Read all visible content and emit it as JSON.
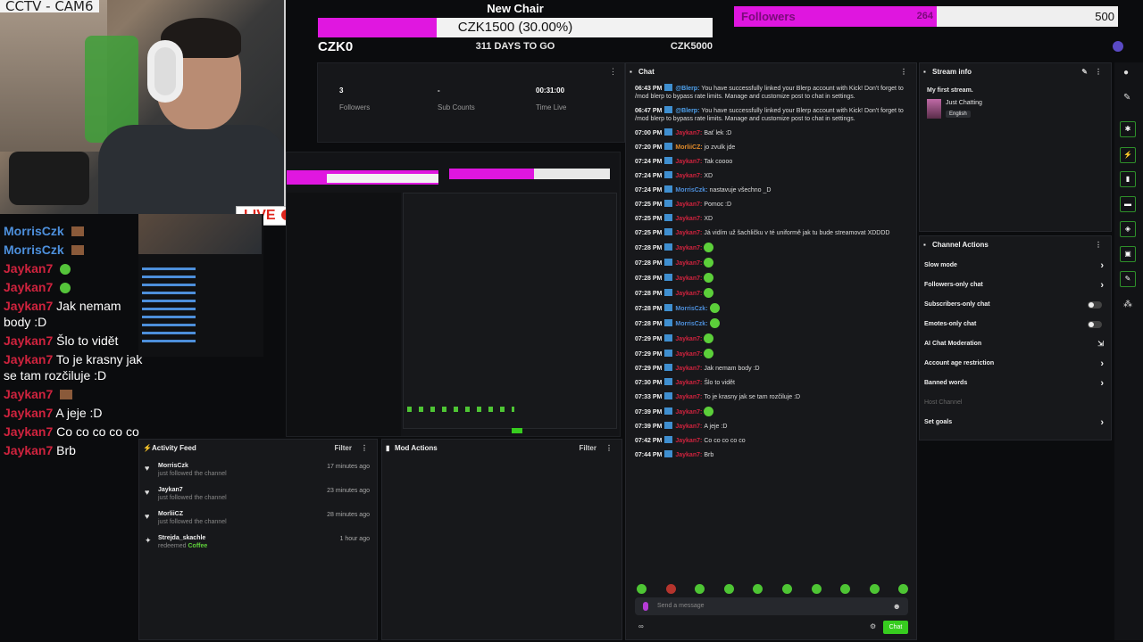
{
  "cam": {
    "label": "CCTV - CAM6",
    "live": "LIVE"
  },
  "goal": {
    "title": "New Chair",
    "progress_text": "CZK1500 (30.00%)",
    "percent": 30,
    "min_label": "CZK0",
    "days_left": "311 DAYS TO GO",
    "max_label": "CZK5000"
  },
  "followers_goal": {
    "label": "Followers",
    "count": "264",
    "goal": "500",
    "fraction": 0.528
  },
  "stats": [
    {
      "value": "3",
      "label": "Followers"
    },
    {
      "value": "-",
      "label": "Sub Counts"
    },
    {
      "value": "00:31:00",
      "label": "Time Live"
    }
  ],
  "overlay_chat": [
    {
      "name": "MorrisCzk",
      "msg": "",
      "color": "#4d8fdb",
      "emote": "brown"
    },
    {
      "name": "MorrisCzk",
      "msg": "",
      "color": "#4d8fdb",
      "emote": "brown"
    },
    {
      "name": "Jaykan7",
      "msg": "",
      "color": "#d0233e",
      "emote": "green"
    },
    {
      "name": "Jaykan7",
      "msg": "",
      "color": "#d0233e",
      "emote": "green"
    },
    {
      "name": "Jaykan7",
      "msg": "Jak nemam body :D",
      "color": "#d0233e",
      "emote": ""
    },
    {
      "name": "Jaykan7",
      "msg": "Šlo to vidět",
      "color": "#d0233e",
      "emote": ""
    },
    {
      "name": "Jaykan7",
      "msg": "To je krasny jak se tam rozčiluje :D",
      "color": "#d0233e",
      "emote": ""
    },
    {
      "name": "Jaykan7",
      "msg": "",
      "color": "#d0233e",
      "emote": "brown"
    },
    {
      "name": "Jaykan7",
      "msg": "A jeje :D",
      "color": "#d0233e",
      "emote": ""
    },
    {
      "name": "Jaykan7",
      "msg": "Co co co co co",
      "color": "#d0233e",
      "emote": ""
    },
    {
      "name": "Jaykan7",
      "msg": "Brb",
      "color": "#d0233e",
      "emote": ""
    }
  ],
  "activity": {
    "title": "Activity Feed",
    "filter": "Filter",
    "rows": [
      {
        "name": "MorrisCzk",
        "sub": "just followed the channel",
        "time": "17 minutes ago",
        "icon": "heart"
      },
      {
        "name": "Jaykan7",
        "sub": "just followed the channel",
        "time": "23 minutes ago",
        "icon": "heart"
      },
      {
        "name": "MorliiCZ",
        "sub": "just followed the channel",
        "time": "28 minutes ago",
        "icon": "heart"
      },
      {
        "name": "Strejda_skachle",
        "sub": "redeemed",
        "reward": "Coffee",
        "time": "1 hour ago",
        "icon": "reward"
      }
    ]
  },
  "mod": {
    "title": "Mod Actions",
    "filter": "Filter"
  },
  "chat": {
    "title": "Chat",
    "messages": [
      {
        "time": "06:43 PM",
        "name": "@Blerp:",
        "cls": "bot",
        "text": "You have successfully linked your Blerp account with Kick! Don't forget to /mod blerp to bypass rate limits. Manage and customize post to chat in settings."
      },
      {
        "time": "06:47 PM",
        "name": "@Blerp:",
        "cls": "bot",
        "text": "You have successfully linked your Blerp account with Kick! Don't forget to /mod blerp to bypass rate limits. Manage and customize post to chat in settings."
      },
      {
        "time": "07:00 PM",
        "name": "Jaykan7:",
        "cls": "red",
        "text": "Bať lek :D"
      },
      {
        "time": "07:20 PM",
        "name": "MorliiCZ:",
        "cls": "orange",
        "text": "jo zvulk jde"
      },
      {
        "time": "07:24 PM",
        "name": "Jaykan7:",
        "cls": "red",
        "text": "Tak coooo"
      },
      {
        "time": "07:24 PM",
        "name": "Jaykan7:",
        "cls": "red",
        "text": "XD"
      },
      {
        "time": "07:24 PM",
        "name": "MorrisCzk:",
        "cls": "blue",
        "text": "nastavuje všechno _D"
      },
      {
        "time": "07:25 PM",
        "name": "Jaykan7:",
        "cls": "red",
        "text": "Pomoc :D"
      },
      {
        "time": "07:25 PM",
        "name": "Jaykan7:",
        "cls": "red",
        "text": "XD"
      },
      {
        "time": "07:25 PM",
        "name": "Jaykan7:",
        "cls": "red",
        "text": "Já vidím už šachličku v té uniformě jak tu bude streamovat XDDDD"
      },
      {
        "time": "07:28 PM",
        "name": "Jaykan7:",
        "cls": "red",
        "text": "",
        "emote": true
      },
      {
        "time": "07:28 PM",
        "name": "Jaykan7:",
        "cls": "red",
        "text": "",
        "emote": true
      },
      {
        "time": "07:28 PM",
        "name": "Jaykan7:",
        "cls": "red",
        "text": "",
        "emote": true
      },
      {
        "time": "07:28 PM",
        "name": "Jaykan7:",
        "cls": "red",
        "text": "",
        "emote": true
      },
      {
        "time": "07:28 PM",
        "name": "MorrisCzk:",
        "cls": "blue",
        "text": "",
        "emote": true
      },
      {
        "time": "07:28 PM",
        "name": "MorrisCzk:",
        "cls": "blue",
        "text": "",
        "emote": true
      },
      {
        "time": "07:29 PM",
        "name": "Jaykan7:",
        "cls": "red",
        "text": "",
        "emote": true
      },
      {
        "time": "07:29 PM",
        "name": "Jaykan7:",
        "cls": "red",
        "text": "",
        "emote": true
      },
      {
        "time": "07:29 PM",
        "name": "Jaykan7:",
        "cls": "red",
        "text": "Jak nemam body :D"
      },
      {
        "time": "07:30 PM",
        "name": "Jaykan7:",
        "cls": "red",
        "text": "Šlo to vidět"
      },
      {
        "time": "07:33 PM",
        "name": "Jaykan7:",
        "cls": "red",
        "text": "To je krasny jak se tam rozčiluje :D"
      },
      {
        "time": "07:39 PM",
        "name": "Jaykan7:",
        "cls": "red",
        "text": "",
        "emote": true
      },
      {
        "time": "07:39 PM",
        "name": "Jaykan7:",
        "cls": "red",
        "text": "A jeje :D"
      },
      {
        "time": "07:42 PM",
        "name": "Jaykan7:",
        "cls": "red",
        "text": "Co co co co co"
      },
      {
        "time": "07:44 PM",
        "name": "Jaykan7:",
        "cls": "red",
        "text": "Brb"
      }
    ],
    "input_placeholder": "Send a message",
    "send_label": "Chat"
  },
  "stream_info": {
    "title": "Stream info",
    "stream_title": "My first stream.",
    "category": "Just Chatting",
    "language": "English"
  },
  "channel_actions": {
    "title": "Channel Actions",
    "rows": [
      {
        "label": "Slow mode",
        "kind": "chevron"
      },
      {
        "label": "Followers-only chat",
        "kind": "chevron"
      },
      {
        "label": "Subscribers-only chat",
        "kind": "toggle"
      },
      {
        "label": "Emotes-only chat",
        "kind": "toggle"
      },
      {
        "label": "AI Chat Moderation",
        "kind": "ext"
      },
      {
        "label": "Account age restriction",
        "kind": "chevron"
      },
      {
        "label": "Banned words",
        "kind": "chevron"
      },
      {
        "label": "Host Channel",
        "kind": "dim"
      },
      {
        "label": "Set goals",
        "kind": "chevron"
      }
    ]
  },
  "colors": {
    "kick_green": "#53fc18",
    "goal_magenta": "#e017e0",
    "red_user": "#d0233e",
    "blue_user": "#4d8fdb"
  }
}
